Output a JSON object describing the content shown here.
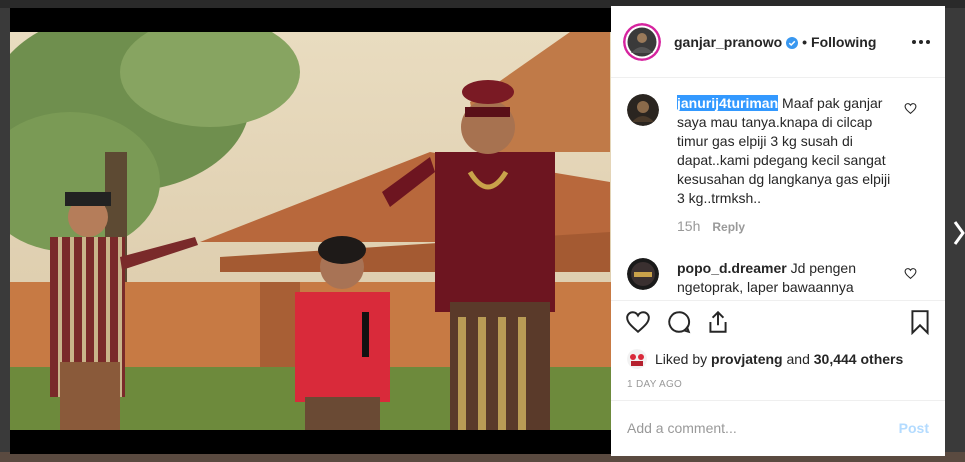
{
  "post": {
    "username": "ganjar_pranowo",
    "separator": "•",
    "follow_status": "Following",
    "more_icon": "more-horizontal-icon"
  },
  "comments": [
    {
      "username": "janurij4turiman",
      "text": " Maaf pak ganjar saya mau tanya.knapa di cilcap timur gas elpiji 3 kg susah di dapat..kami pdegang kecil sangat kesusahan dg langkanya gas elpiji 3 kg..trmksh..",
      "age": "15h",
      "reply_label": "Reply"
    },
    {
      "username": "popo_d.dreamer",
      "text": " Jd pengen ngetoprak, laper bawaannya"
    }
  ],
  "likes": {
    "prefix": "Liked by ",
    "user": "provjateng",
    "middle": " and ",
    "count": "30,444 others"
  },
  "timestamp": "1 DAY AGO",
  "add_comment": {
    "placeholder": "Add a comment...",
    "post_label": "Post"
  },
  "colors": {
    "verified": "#3897f0",
    "highlight": "#3399ff",
    "muted": "#999999",
    "post_disabled": "#b3dbff"
  }
}
